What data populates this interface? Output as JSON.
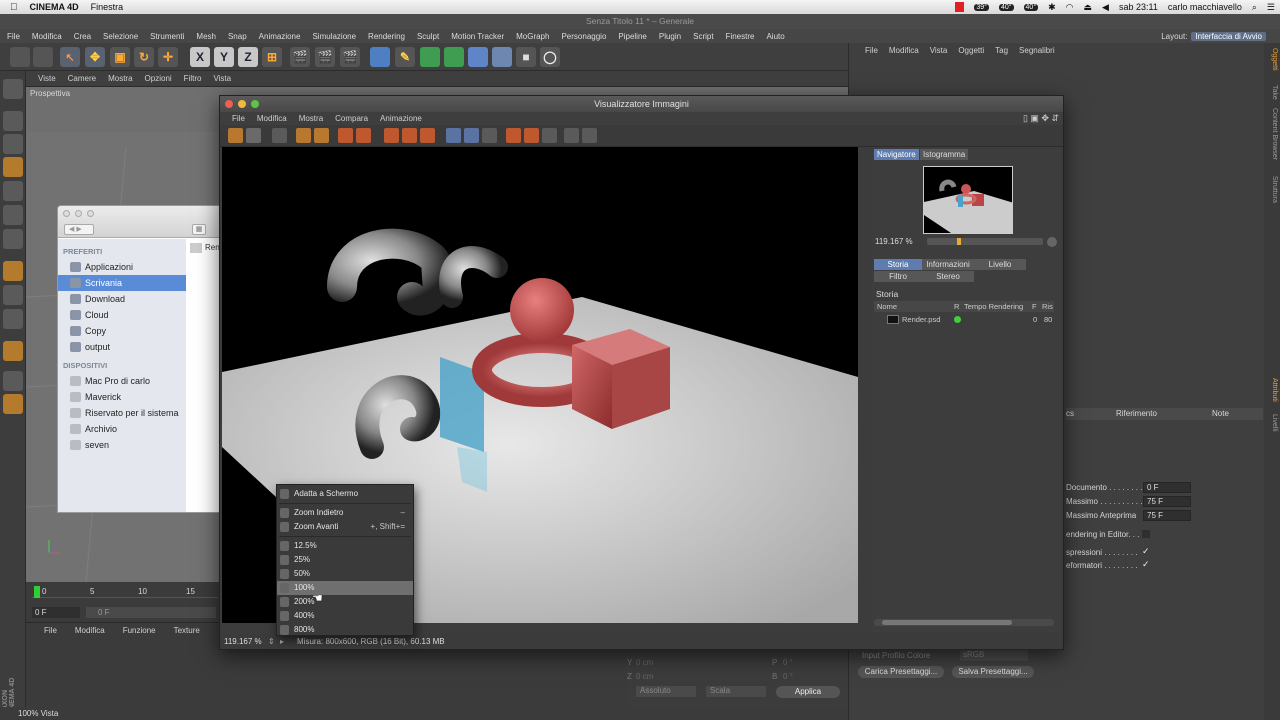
{
  "menubar": {
    "apple": "",
    "app": "CINEMA 4D",
    "menu": "Finestra",
    "badges": [
      "39°",
      "40°",
      "40°"
    ],
    "clock": "sab 23:11",
    "user": "carlo macchiavello"
  },
  "c4d": {
    "title": "Senza Titolo 11 * – Generale",
    "menu": [
      "File",
      "Modifica",
      "Crea",
      "Selezione",
      "Strumenti",
      "Mesh",
      "Snap",
      "Animazione",
      "Simulazione",
      "Rendering",
      "Sculpt",
      "Motion Tracker",
      "MoGraph",
      "Personaggio",
      "Pipeline",
      "Plugin",
      "Script",
      "Finestre",
      "Aiuto"
    ],
    "layout_label": "Layout:",
    "layout_value": "Interfaccia di Avvio",
    "axis_x": "X",
    "axis_y": "Y",
    "axis_z": "Z"
  },
  "viewport": {
    "menu": [
      "Viste",
      "Camere",
      "Mostra",
      "Opzioni",
      "Filtro",
      "Vista"
    ],
    "label": "Prospettiva"
  },
  "timeline": {
    "ticks": [
      "0",
      "5",
      "10",
      "15"
    ],
    "field1": "0 F",
    "field2": "0 F"
  },
  "bottom": {
    "menu": [
      "File",
      "Modifica",
      "Funzione",
      "Texture"
    ]
  },
  "status": "100% Vista",
  "right": {
    "menu": [
      "File",
      "Modifica",
      "Vista",
      "Oggetti",
      "Tag",
      "Segnalibri"
    ],
    "side_tabs": [
      "Oggetti",
      "Take",
      "Content Browser",
      "Struttura"
    ],
    "side_tabs2": [
      "Attributi",
      "Livelli"
    ]
  },
  "attributes": {
    "col_riferimento": "Riferimento",
    "col_note": "Note",
    "col_cs": "cs",
    "rows": [
      {
        "label": "Documento . . . . . . . .",
        "value": "0 F"
      },
      {
        "label": "Massimo . . . . . . . . . .",
        "value": "75 F"
      },
      {
        "label": "Massimo Anteprima",
        "value": "75 F"
      }
    ],
    "rendering_editor": "endering in Editor. . .",
    "espressioni": "spressioni . . . . . . . .",
    "deformatori": "eformatori . . . . . . . .",
    "input_profilo": "Input Profilo Colore",
    "srgb": "sRGB",
    "carica": "Carica Presettaggi...",
    "salva": "Salva Presettaggi...",
    "y_cm": "0 cm",
    "z_cm": "0 cm",
    "p_deg": "0 °",
    "b_deg": "0 °",
    "y_label": "Y",
    "z_label": "Z",
    "p_label": "P",
    "b_label": "B",
    "assoluto": "Assoluto",
    "scala": "Scala",
    "applica": "Applica"
  },
  "finder": {
    "preferiti": "PREFERITI",
    "favorites": [
      "Applicazioni",
      "Scrivania",
      "Download",
      "Cloud",
      "Copy",
      "output"
    ],
    "selected": "Scrivania",
    "dispositivi": "DISPOSITIVI",
    "devices": [
      "Mac Pro di carlo",
      "Maverick",
      "Riservato per il sistema",
      "Archivio",
      "seven"
    ],
    "column_item": "Ren"
  },
  "viewer": {
    "title": "Visualizzatore Immagini",
    "menu": [
      "File",
      "Modifica",
      "Mostra",
      "Compara",
      "Animazione"
    ],
    "zoom": "119.167 %",
    "status": "Misura: 800x600, RGB (16 Bit), 60.13 MB",
    "nav_tabs": [
      "Navigatore",
      "Istogramma"
    ],
    "nav_zoom": "119.167 %",
    "info_tabs": [
      "Storia",
      "Informazioni",
      "Livello",
      "Filtro",
      "Stereo"
    ],
    "storia_title": "Storia",
    "columns": [
      "Nome",
      "R",
      "Tempo Rendering",
      "F",
      "Ris"
    ],
    "row": {
      "name": "Render.psd",
      "time": "",
      "f": "0",
      "ris": "80"
    }
  },
  "zoom_menu": {
    "items": [
      {
        "label": "Adatta a Schermo",
        "shortcut": ""
      },
      {
        "label": "Zoom Indietro",
        "shortcut": "–"
      },
      {
        "label": "Zoom Avanti",
        "shortcut": "+, Shift+="
      },
      {
        "label": "12.5%",
        "shortcut": ""
      },
      {
        "label": "25%",
        "shortcut": ""
      },
      {
        "label": "50%",
        "shortcut": ""
      },
      {
        "label": "100%",
        "shortcut": ""
      },
      {
        "label": "200%",
        "shortcut": ""
      },
      {
        "label": "400%",
        "shortcut": ""
      },
      {
        "label": "800%",
        "shortcut": ""
      }
    ],
    "highlighted": "100%"
  },
  "colors": {
    "accent": "#5e7cb0",
    "finder_selection": "#5a8bd6",
    "status_green": "#3fcf3f"
  }
}
